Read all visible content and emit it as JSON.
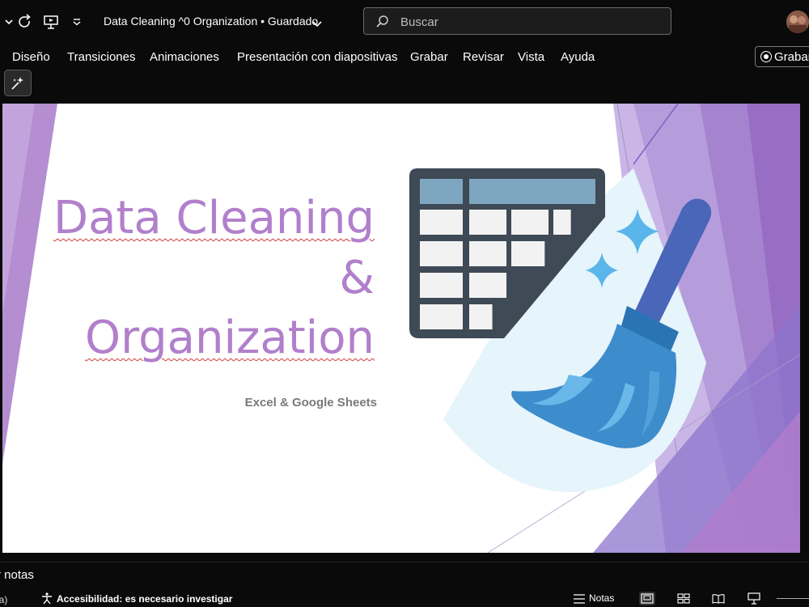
{
  "titlebar": {
    "doc_title": "Data Cleaning ^0 Organization • Guardado",
    "search_placeholder": "Buscar"
  },
  "menu": {
    "items": [
      "Diseño",
      "Transiciones",
      "Animaciones",
      "Presentación con diapositivas",
      "Grabar",
      "Revisar",
      "Vista",
      "Ayuda"
    ],
    "record_button": "Grabar"
  },
  "slide": {
    "title_line1": "Data Cleaning",
    "title_line2": "&",
    "title_line3": "Organization",
    "subtitle": "Excel & Google Sheets"
  },
  "notes": {
    "label": "r notas"
  },
  "status": {
    "left_fragment": "na)",
    "accessibility": "Accesibilidad: es necesario investigar",
    "notes_button": "Notas"
  },
  "colors": {
    "title_purple": "#b17fcb",
    "app_bg": "#0a0a0a",
    "broom_blue": "#2f7fc0",
    "sparkle_blue": "#5ab6ea"
  },
  "icons": [
    "undo-chevron-icon",
    "redo-icon",
    "present-icon",
    "customize-chevron-icon",
    "search-icon",
    "designer-icon",
    "accessibility-icon",
    "notes-icon",
    "normal-view-icon",
    "slide-sorter-icon",
    "reading-view-icon",
    "slideshow-icon"
  ]
}
